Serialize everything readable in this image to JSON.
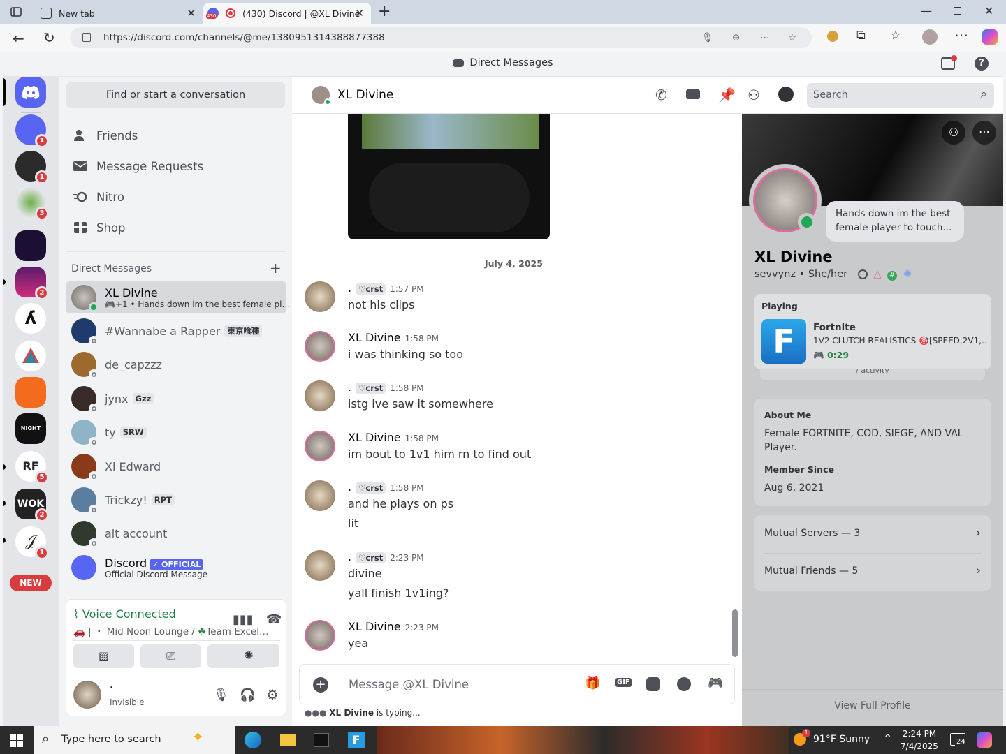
{
  "browser": {
    "tabs": [
      {
        "label": "New tab",
        "active": false
      },
      {
        "label": "(430) Discord | @XL Divine",
        "active": true,
        "favicon_badge": "430"
      }
    ],
    "url": "https://discord.com/channels/@me/1380951314388877388"
  },
  "discord": {
    "title_strip": "Direct Messages",
    "guild_badges": [
      "1",
      "1",
      "3",
      "",
      "2",
      "",
      "",
      "",
      "",
      "5",
      "2",
      "1"
    ],
    "new_pill": "NEW",
    "search_conversation": "Find or start a conversation",
    "nav": [
      {
        "label": "Friends",
        "icon": "friends-icon"
      },
      {
        "label": "Message Requests",
        "icon": "envelope-icon"
      },
      {
        "label": "Nitro",
        "icon": "nitro-icon"
      },
      {
        "label": "Shop",
        "icon": "shop-icon"
      }
    ],
    "dm_header": "Direct Messages",
    "dms": [
      {
        "name": "XL Divine",
        "sub": "+1 • Hands down im the best female pl…",
        "selected": true
      },
      {
        "name": "#Wannabe a Rapper",
        "tag": "東京喰種"
      },
      {
        "name": "de_capzzz"
      },
      {
        "name": "jynx",
        "tag": "Gzz"
      },
      {
        "name": "ty",
        "tag": "SRW"
      },
      {
        "name": "Xl Edward"
      },
      {
        "name": "Trickzy!",
        "tag": "RPT"
      },
      {
        "name": "alt account"
      },
      {
        "name": "Discord",
        "badge": "✓ OFFICIAL",
        "sub": "Official Discord Message"
      }
    ],
    "voice": {
      "status": "Voice Connected",
      "channel": "・ Mid Noon Lounge / ",
      "server": "Team Excel…"
    },
    "user": {
      "name": ".",
      "status": "Invisible"
    },
    "chat": {
      "recipient": "XL Divine",
      "search_placeholder": "Search",
      "date_divider": "July 4, 2025",
      "messages": [
        {
          "author": ".",
          "tag": "crst",
          "time": "1:57 PM",
          "lines": [
            "not his clips"
          ]
        },
        {
          "author": "XL Divine",
          "time": "1:58 PM",
          "lines": [
            "i was thinking so too"
          ]
        },
        {
          "author": ".",
          "tag": "crst",
          "time": "1:58 PM",
          "lines": [
            "istg ive saw it somewhere"
          ]
        },
        {
          "author": "XL Divine",
          "time": "1:58 PM",
          "lines": [
            "im bout to 1v1 him rn to find out"
          ]
        },
        {
          "author": ".",
          "tag": "crst",
          "time": "1:58 PM",
          "lines": [
            "and he plays on ps",
            "lit"
          ]
        },
        {
          "author": ".",
          "tag": "crst",
          "time": "2:23 PM",
          "lines": [
            "divine",
            "yall finish 1v1ing?"
          ]
        },
        {
          "author": "XL Divine",
          "time": "2:23 PM",
          "lines": [
            "yea"
          ]
        }
      ],
      "composer_placeholder": "Message @XL Divine",
      "typing_user": "XL Divine",
      "typing_suffix": " is typing..."
    },
    "profile": {
      "status_bubble": "Hands down im the best female player to touch...",
      "display_name": "XL Divine",
      "username": "sevvynz",
      "pronouns": "She/her",
      "activity_header": "Playing",
      "game": "Fortnite",
      "game_detail": "1V2 CLUTCH REALISTICS 🎯[SPEED,2V1,…",
      "elapsed": "0:29",
      "activity_more": "/ activity",
      "about_label": "About Me",
      "about_text": "Female FORTNITE, COD, SIEGE, AND VAL Player.",
      "member_since_label": "Member Since",
      "member_since": "Aug 6, 2021",
      "mutual_servers": "Mutual Servers — 3",
      "mutual_friends": "Mutual Friends — 5",
      "view_full": "View Full Profile"
    }
  },
  "taskbar": {
    "search_placeholder": "Type here to search",
    "weather": "91°F  Sunny",
    "weather_badge": "1",
    "time": "2:24 PM",
    "date": "7/4/2025",
    "notif_count": "24"
  },
  "colors": {
    "blurple": "#5865f2",
    "online": "#23a55a",
    "badge": "#d83c3e",
    "green_text": "#248046"
  }
}
